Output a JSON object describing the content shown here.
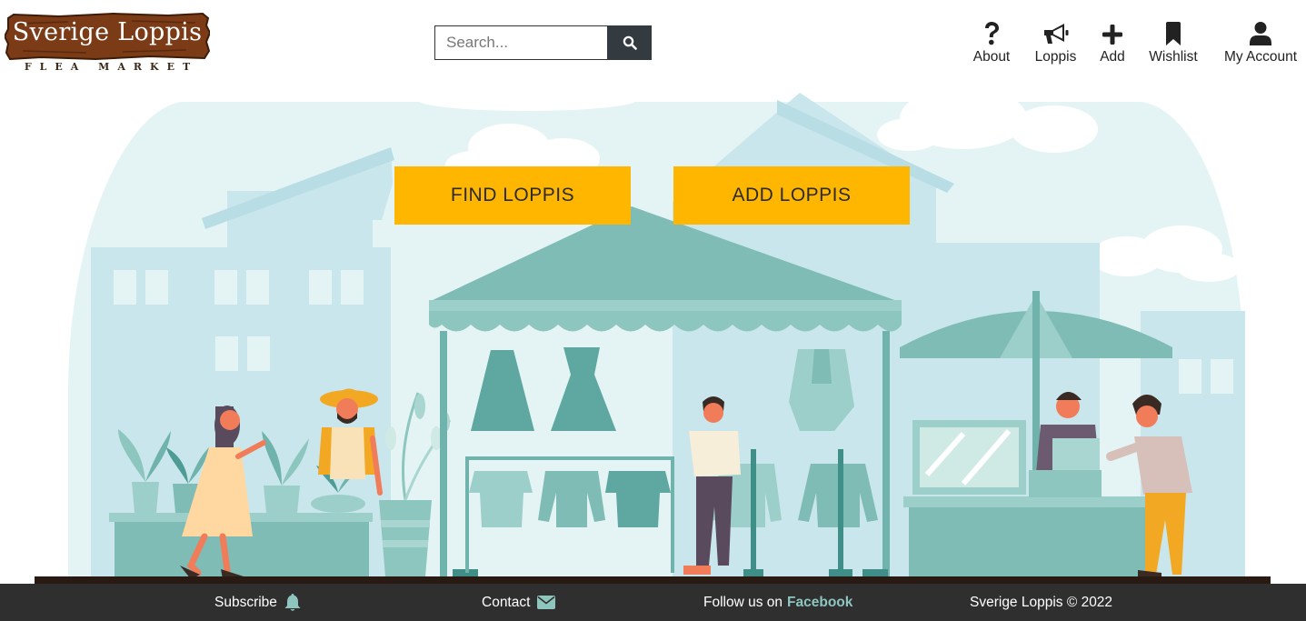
{
  "brand": {
    "name": "Sverige Loppis",
    "tagline": "FLEA MARKET"
  },
  "search": {
    "placeholder": "Search...",
    "icon": "search-icon"
  },
  "nav": [
    {
      "label": "About",
      "icon": "question-icon"
    },
    {
      "label": "Loppis",
      "icon": "megaphone-icon"
    },
    {
      "label": "Add",
      "icon": "plus-icon"
    },
    {
      "label": "Wishlist",
      "icon": "bookmark-icon"
    },
    {
      "label": "My Account",
      "icon": "user-icon"
    }
  ],
  "hero": {
    "find_button": "FIND LOPPIS",
    "add_button": "ADD LOPPIS"
  },
  "footer": {
    "subscribe": "Subscribe",
    "contact": "Contact",
    "follow_prefix": "Follow us on",
    "follow_link": "Facebook",
    "copyright": "Sverige Loppis © 2022"
  },
  "colors": {
    "accent": "#ffb600",
    "footer_bg": "#2f2f2f",
    "footer_link": "#8ec5bf",
    "search_button": "#333a40",
    "teal": "#6fb3ac"
  }
}
